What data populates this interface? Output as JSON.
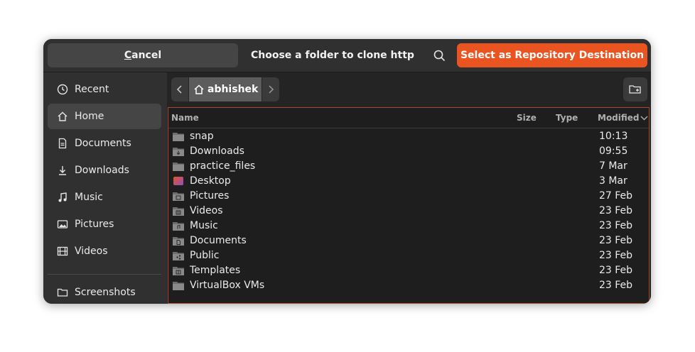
{
  "header": {
    "cancel_label_mnemonic": "C",
    "cancel_label_rest": "ancel",
    "title": "Choose a folder to clone http...",
    "search_icon": "search-icon",
    "select_label": "Select as Repository Destination",
    "accent": "#e95420"
  },
  "sidebar": {
    "items": [
      {
        "label": "Recent",
        "icon": "clock-icon"
      },
      {
        "label": "Home",
        "icon": "home-icon"
      },
      {
        "label": "Documents",
        "icon": "document-icon"
      },
      {
        "label": "Downloads",
        "icon": "download-icon"
      },
      {
        "label": "Music",
        "icon": "music-icon"
      },
      {
        "label": "Pictures",
        "icon": "picture-icon"
      },
      {
        "label": "Videos",
        "icon": "video-icon"
      },
      {
        "label": "Screenshots",
        "icon": "folder-icon"
      }
    ],
    "active": "Home"
  },
  "pathbar": {
    "crumb": "abhishek"
  },
  "columns": {
    "name": "Name",
    "size": "Size",
    "type": "Type",
    "modified": "Modified"
  },
  "files": [
    {
      "name": "snap",
      "modified": "10:13"
    },
    {
      "name": "Downloads",
      "modified": "09:55"
    },
    {
      "name": "practice_files",
      "modified": "7 Mar"
    },
    {
      "name": "Desktop",
      "modified": "3 Mar"
    },
    {
      "name": "Pictures",
      "modified": "27 Feb"
    },
    {
      "name": "Videos",
      "modified": "23 Feb"
    },
    {
      "name": "Music",
      "modified": "23 Feb"
    },
    {
      "name": "Documents",
      "modified": "23 Feb"
    },
    {
      "name": "Public",
      "modified": "23 Feb"
    },
    {
      "name": "Templates",
      "modified": "23 Feb"
    },
    {
      "name": "VirtualBox VMs",
      "modified": "23 Feb"
    }
  ]
}
